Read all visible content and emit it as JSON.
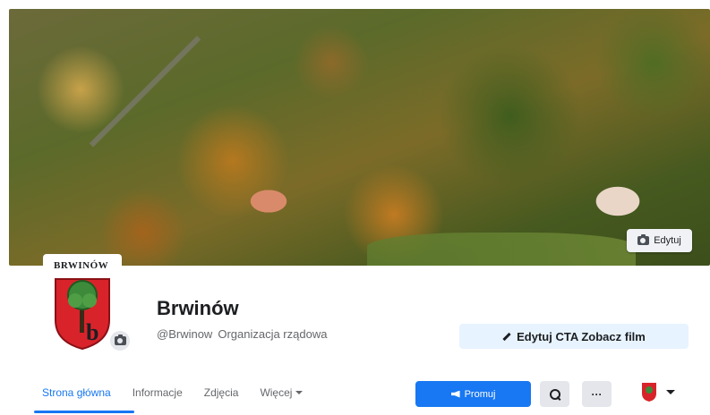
{
  "cover": {
    "edit_label": "Edytuj"
  },
  "profile": {
    "crest_text": "BRWINÓW",
    "crest_letter": "b",
    "name": "Brwinów",
    "handle": "@Brwinow",
    "category": "Organizacja rządowa"
  },
  "cta": {
    "label": "Edytuj CTA Zobacz film"
  },
  "tabs": [
    {
      "label": "Strona główna",
      "active": true
    },
    {
      "label": "Informacje",
      "active": false
    },
    {
      "label": "Zdjęcia",
      "active": false
    },
    {
      "label": "Więcej",
      "active": false
    }
  ],
  "actions": {
    "promote_label": "Promuj",
    "more_label": "···"
  },
  "colors": {
    "accent": "#1877f2",
    "crest_red": "#d9232b",
    "crest_green": "#3c8a3a"
  },
  "icons": {
    "camera": "camera-icon",
    "pencil": "pencil-icon",
    "megaphone": "megaphone-icon",
    "search": "search-icon",
    "more": "more-icon",
    "dropdown": "chevron-down-icon"
  }
}
